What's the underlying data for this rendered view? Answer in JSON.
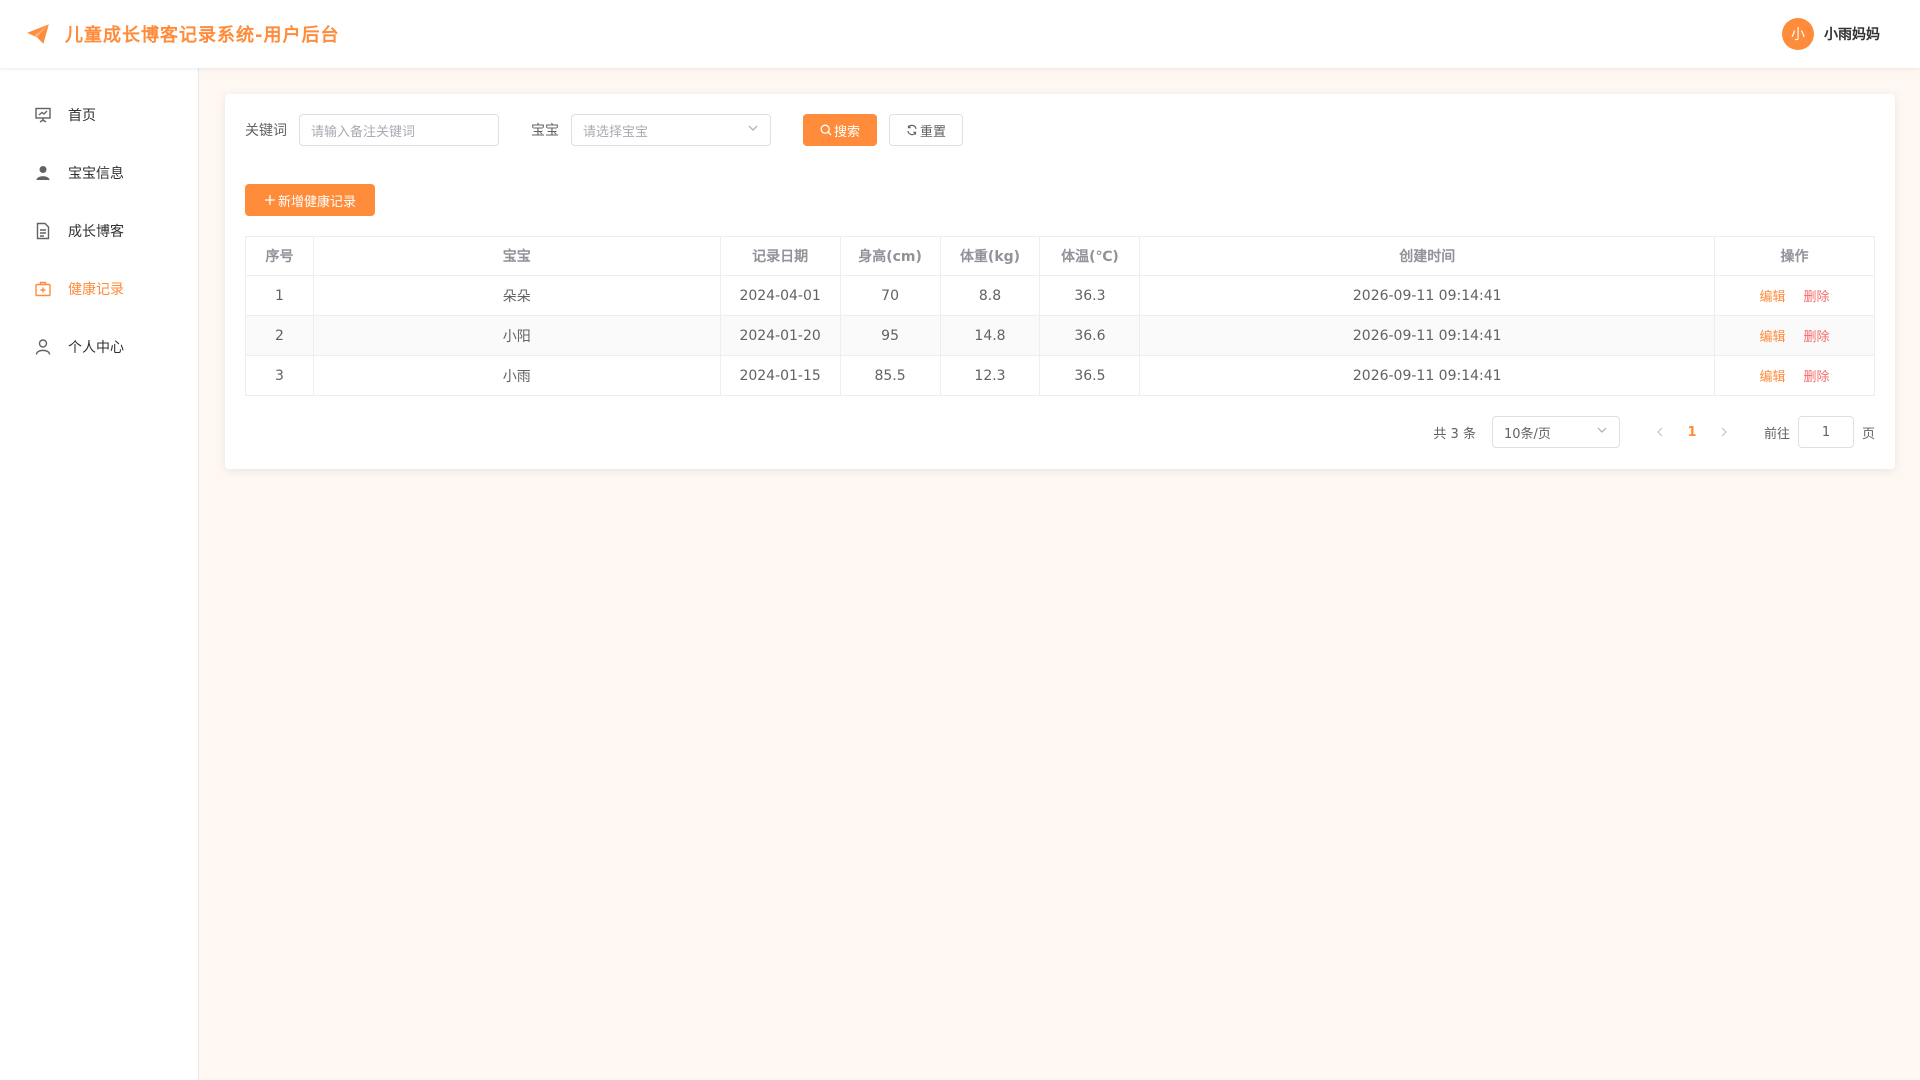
{
  "app": {
    "title": "儿童成长博客记录系统-用户后台",
    "accent_color": "#ff8c3a",
    "danger_color": "#f56c6c"
  },
  "user": {
    "avatar_text": "小",
    "name": "小雨妈妈"
  },
  "sidebar": {
    "items": [
      {
        "label": "首页",
        "icon": "presentation-icon",
        "active": false
      },
      {
        "label": "宝宝信息",
        "icon": "user-icon",
        "active": false
      },
      {
        "label": "成长博客",
        "icon": "document-icon",
        "active": false
      },
      {
        "label": "健康记录",
        "icon": "medical-kit-icon",
        "active": true
      },
      {
        "label": "个人中心",
        "icon": "user-outline-icon",
        "active": false
      }
    ]
  },
  "search": {
    "keyword_label": "关键词",
    "keyword_placeholder": "请输入备注关键词",
    "baby_label": "宝宝",
    "baby_placeholder": "请选择宝宝",
    "search_button": "搜索",
    "reset_button": "重置"
  },
  "toolbar": {
    "add_button": "新增健康记录"
  },
  "table": {
    "headers": [
      "序号",
      "宝宝",
      "记录日期",
      "身高(cm)",
      "体重(kg)",
      "体温(℃)",
      "创建时间",
      "操作"
    ],
    "rows": [
      {
        "index": "1",
        "baby": "朵朵",
        "date": "2024-04-01",
        "height": "70",
        "weight": "8.8",
        "temp": "36.3",
        "created": "2026-09-11 09:14:41"
      },
      {
        "index": "2",
        "baby": "小阳",
        "date": "2024-01-20",
        "height": "95",
        "weight": "14.8",
        "temp": "36.6",
        "created": "2026-09-11 09:14:41"
      },
      {
        "index": "3",
        "baby": "小雨",
        "date": "2024-01-15",
        "height": "85.5",
        "weight": "12.3",
        "temp": "36.5",
        "created": "2026-09-11 09:14:41"
      }
    ],
    "edit_label": "编辑",
    "delete_label": "删除"
  },
  "pagination": {
    "total_text": "共 3 条",
    "page_size": "10条/页",
    "current_page": "1",
    "goto_prefix": "前往",
    "goto_value": "1",
    "goto_suffix": "页"
  }
}
